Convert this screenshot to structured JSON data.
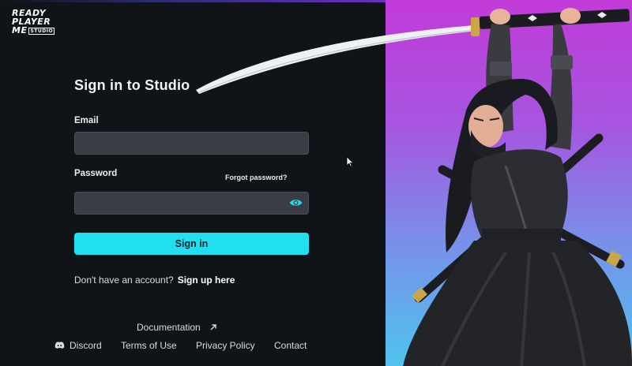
{
  "brand": {
    "logo_line1": "READY",
    "logo_line2": "PLAYER",
    "logo_line3": "ME",
    "logo_tag": "STUDIO"
  },
  "form": {
    "title": "Sign in to Studio",
    "email_label": "Email",
    "email_value": "",
    "password_label": "Password",
    "password_value": "",
    "forgot_password": "Forgot password?",
    "signin_button": "Sign in",
    "no_account_text": "Don't have an account?",
    "signup_link": "Sign up here"
  },
  "footer": {
    "documentation": "Documentation",
    "discord": "Discord",
    "terms": "Terms of Use",
    "privacy": "Privacy Policy",
    "contact": "Contact"
  },
  "icons": {
    "password_toggle": "eye-icon",
    "docs_link": "external-arrow-icon",
    "discord": "discord-icon"
  },
  "colors": {
    "accent": "#20e0f0",
    "background": "#101317",
    "input_bg": "#3a3d45",
    "hero_top": "#c23bd8",
    "hero_bottom": "#4fc4ee"
  }
}
